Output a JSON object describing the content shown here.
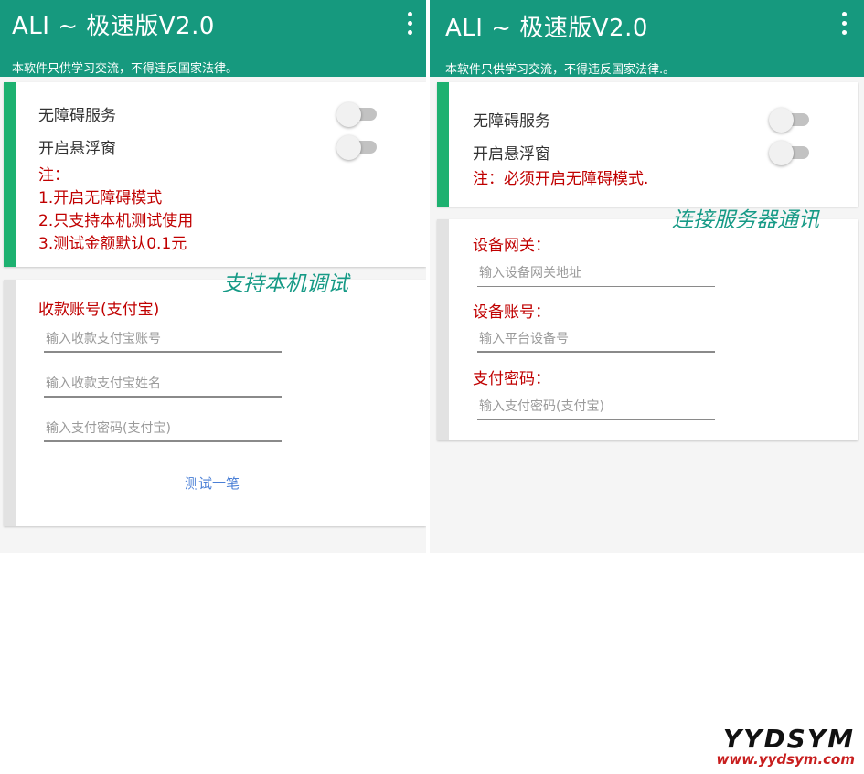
{
  "left": {
    "app_title": "ALI ~ 极速版V2.0",
    "subtitle": "本软件只供学习交流，不得违反国家法律。",
    "toggles": [
      {
        "label": "无障碍服务",
        "state": "off"
      },
      {
        "label": "开启悬浮窗",
        "state": "off"
      }
    ],
    "note_title": "注：",
    "notes": [
      "1.开启无障碍模式",
      "2.只支持本机测试使用",
      "3.测试金额默认0.1元"
    ],
    "section_label": "收款账号(支付宝)",
    "inputs": [
      {
        "placeholder": "输入收款支付宝账号"
      },
      {
        "placeholder": "输入收款支付宝姓名"
      },
      {
        "placeholder": "输入支付密码(支付宝)"
      }
    ],
    "test_button": "测试一笔",
    "annotation": "支持本机调试"
  },
  "right": {
    "app_title": "ALI ~ 极速版V2.0",
    "subtitle": "本软件只供学习交流，不得违反国家法律.。",
    "toggles": [
      {
        "label": "无障碍服务",
        "state": "off"
      },
      {
        "label": "开启悬浮窗",
        "state": "off"
      }
    ],
    "note": "注：必须开启无障碍模式.",
    "annotation": "连接服务器通讯",
    "fields": [
      {
        "label": "设备网关：",
        "placeholder": "输入设备网关地址"
      },
      {
        "label": "设备账号：",
        "placeholder": "输入平台设备号"
      },
      {
        "label": "支付密码：",
        "placeholder": "输入支付密码(支付宝)"
      }
    ]
  },
  "watermark": {
    "brand": "YYDSYM",
    "url": "www.yydsym.com"
  },
  "colors": {
    "appbar": "#16997e",
    "accent_stripe": "#1db170",
    "note_red": "#c00000",
    "link_blue": "#4a7fd6",
    "annotation_teal": "#169a86"
  }
}
